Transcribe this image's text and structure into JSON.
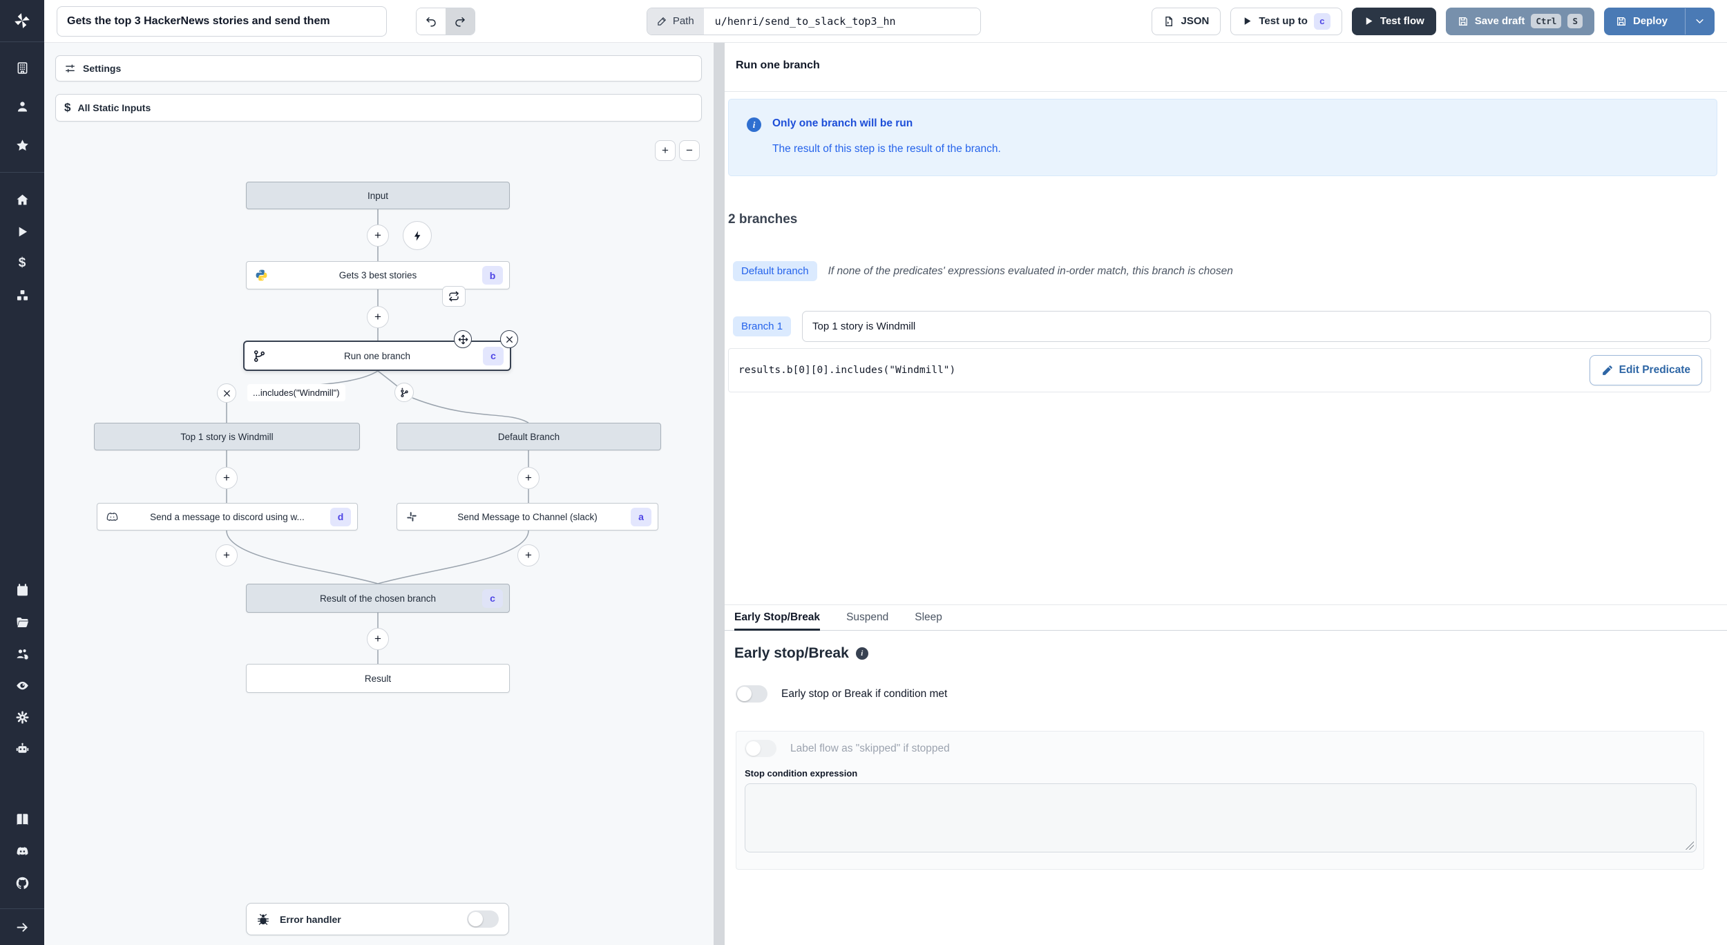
{
  "topbar": {
    "title_value": "Gets the top 3 HackerNews stories and send them",
    "path_label": "Path",
    "path_value": "u/henri/send_to_slack_top3_hn",
    "json_label": "JSON",
    "test_up_to_label": "Test up to",
    "test_up_to_badge": "c",
    "test_flow_label": "Test flow",
    "save_draft_label": "Save draft",
    "kbd_ctrl": "Ctrl",
    "kbd_s": "S",
    "deploy_label": "Deploy"
  },
  "canvas": {
    "settings_label": "Settings",
    "static_inputs_label": "All Static Inputs",
    "zoom_in": "+",
    "zoom_out": "−",
    "nodes": {
      "input": {
        "label": "Input"
      },
      "gets_stories": {
        "label": "Gets 3 best stories",
        "badge": "b"
      },
      "run_one_branch": {
        "label": "Run one branch",
        "badge": "c"
      },
      "predicate_pill": {
        "label": "...includes(\"Windmill\")"
      },
      "branch_windmill": {
        "label": "Top 1 story is Windmill"
      },
      "branch_default": {
        "label": "Default Branch"
      },
      "discord": {
        "label": "Send a message to discord using w...",
        "badge": "d"
      },
      "slack": {
        "label": "Send Message to Channel (slack)",
        "badge": "a"
      },
      "result_branch": {
        "label": "Result of the chosen branch",
        "badge": "c"
      },
      "result": {
        "label": "Result"
      },
      "error_handler": {
        "label": "Error handler"
      }
    }
  },
  "panel": {
    "title": "Run one branch",
    "info": {
      "title": "Only one branch will be run",
      "body": "The result of this step is the result of the branch."
    },
    "branches_heading": "2 branches",
    "default_branch": {
      "badge": "Default branch",
      "description": "If none of the predicates' expressions evaluated in-order match, this branch is chosen"
    },
    "branch_1": {
      "badge": "Branch 1",
      "summary_value": "Top 1 story is Windmill",
      "predicate_code": "results.b[0][0].includes(\"Windmill\")",
      "edit_button": "Edit Predicate"
    },
    "tabs": [
      {
        "label": "Early Stop/Break"
      },
      {
        "label": "Suspend"
      },
      {
        "label": "Sleep"
      }
    ],
    "early_stop": {
      "heading": "Early stop/Break",
      "toggle_label": "Early stop or Break if condition met",
      "skipped_toggle_label": "Label flow as \"skipped\" if stopped",
      "expression_label": "Stop condition expression"
    }
  },
  "colors": {
    "sidebar_bg": "#242b3a",
    "accent_indigo": "#4f46e5",
    "accent_blue": "#2563eb",
    "deploy_blue": "#4a7ab5",
    "save_slate": "#7790ac",
    "dark_button": "#2b3645",
    "info_bg": "#e9f3fd",
    "canvas_bg": "#f6f8fa"
  }
}
